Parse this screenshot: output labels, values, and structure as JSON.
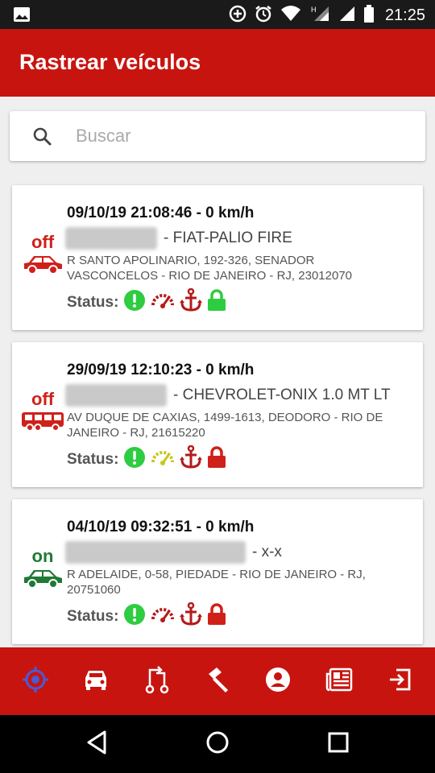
{
  "status_bar": {
    "time": "21:25",
    "icons": [
      "image-icon",
      "add-circle-icon",
      "alarm-icon",
      "wifi-icon",
      "signal-h-icon",
      "signal-icon",
      "battery-icon"
    ]
  },
  "app_bar": {
    "title": "Rastrear veículos"
  },
  "search": {
    "placeholder": "Buscar",
    "value": ""
  },
  "vehicles": [
    {
      "state": "off",
      "vehicle_icon": "car-icon",
      "header": "09/10/19 21:08:46 - 0 km/h",
      "model": "- FIAT-PALIO FIRE",
      "address": "R SANTO APOLINARIO, 192-326, SENADOR VASCONCELOS - RIO DE JANEIRO - RJ, 23012070",
      "status_label": "Status:",
      "status_icons": [
        {
          "name": "alert-icon",
          "color": "#2ecc40"
        },
        {
          "name": "speedometer-icon",
          "color": "#b31b1b"
        },
        {
          "name": "anchor-icon",
          "color": "#b31b1b"
        },
        {
          "name": "lock-icon",
          "color": "#2ecc40"
        }
      ]
    },
    {
      "state": "off",
      "vehicle_icon": "bus-icon",
      "header": "29/09/19 12:10:23 - 0 km/h",
      "model": "- CHEVROLET-ONIX 1.0 MT LT",
      "address": "AV DUQUE DE CAXIAS, 1499-1613, DEODORO - RIO DE JANEIRO - RJ, 21615220",
      "status_label": "Status:",
      "status_icons": [
        {
          "name": "alert-icon",
          "color": "#2ecc40"
        },
        {
          "name": "speedometer-icon",
          "color": "#c4c81e"
        },
        {
          "name": "anchor-icon",
          "color": "#b31b1b"
        },
        {
          "name": "lock-icon",
          "color": "#d0201a"
        }
      ]
    },
    {
      "state": "on",
      "vehicle_icon": "car-icon",
      "header": "04/10/19 09:32:51 - 0 km/h",
      "model": "- x-x",
      "address": "R ADELAIDE, 0-58, PIEDADE - RIO DE JANEIRO - RJ, 20751060",
      "status_label": "Status:",
      "status_icons": [
        {
          "name": "alert-icon",
          "color": "#2ecc40"
        },
        {
          "name": "speedometer-icon",
          "color": "#b31b1b"
        },
        {
          "name": "anchor-icon",
          "color": "#b31b1b"
        },
        {
          "name": "lock-icon",
          "color": "#d0201a"
        }
      ]
    }
  ],
  "bottom_nav": [
    {
      "name": "track-icon",
      "active": true
    },
    {
      "name": "vehicles-icon",
      "active": false
    },
    {
      "name": "route-icon",
      "active": false
    },
    {
      "name": "tools-icon",
      "active": false
    },
    {
      "name": "account-icon",
      "active": false
    },
    {
      "name": "news-icon",
      "active": false
    },
    {
      "name": "logout-icon",
      "active": false
    }
  ],
  "colors": {
    "primary": "#c8140f",
    "status_bar": "#1a1a1a",
    "off": "#d0201a",
    "on": "#1e7a34",
    "active_nav": "#4a5bd4"
  }
}
